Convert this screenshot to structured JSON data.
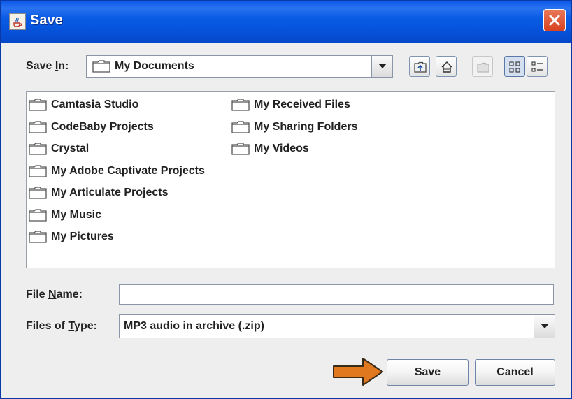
{
  "window": {
    "title": "Save"
  },
  "save_in": {
    "label_pre": "Save ",
    "label_mnemonic": "I",
    "label_post": "n:",
    "selected": "My Documents"
  },
  "toolbar": {
    "buttons": [
      {
        "name": "up-one-level-icon",
        "enabled": true
      },
      {
        "name": "home-icon",
        "enabled": true
      },
      {
        "name": "new-folder-icon",
        "enabled": false
      },
      {
        "name": "list-view-icon",
        "enabled": true,
        "selected": true
      },
      {
        "name": "details-view-icon",
        "enabled": true
      }
    ]
  },
  "files": {
    "column1": [
      "Camtasia Studio",
      "CodeBaby Projects",
      "Crystal",
      "My Adobe Captivate Projects",
      "My Articulate Projects",
      "My Music",
      "My Pictures"
    ],
    "column2": [
      "My Received Files",
      "My Sharing Folders",
      "My Videos"
    ]
  },
  "file_name": {
    "label_pre": "File ",
    "label_mnemonic": "N",
    "label_post": "ame:",
    "value": ""
  },
  "files_of_type": {
    "label_pre": "Files of ",
    "label_mnemonic": "T",
    "label_post": "ype:",
    "selected": "MP3 audio in archive (.zip)"
  },
  "buttons": {
    "save": "Save",
    "cancel": "Cancel"
  },
  "colors": {
    "titlebar": "#0a5ce6",
    "annotation_arrow": "#e07820",
    "close_button": "#d8421f"
  }
}
